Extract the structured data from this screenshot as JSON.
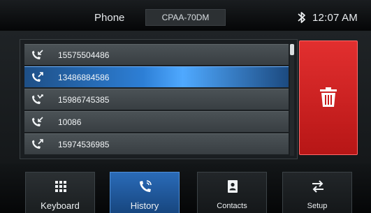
{
  "header": {
    "title": "Phone",
    "device": "CPAA-70DM",
    "time": "12:07 AM",
    "bluetooth_icon": "bluetooth-icon"
  },
  "call_history": [
    {
      "number": "15575504486",
      "icon": "incoming-call-icon",
      "selected": false
    },
    {
      "number": "13486884586",
      "icon": "outgoing-call-icon",
      "selected": true
    },
    {
      "number": "15986745385",
      "icon": "missed-call-icon",
      "selected": false
    },
    {
      "number": "10086",
      "icon": "incoming-call-icon",
      "selected": false
    },
    {
      "number": "15974536985",
      "icon": "outgoing-call-icon",
      "selected": false
    }
  ],
  "delete_button": {
    "icon": "trash-icon"
  },
  "tabs": [
    {
      "label": "Keyboard",
      "icon": "keypad-icon"
    },
    {
      "label": "History",
      "icon": "phone-history-icon"
    },
    {
      "label": "Contacts",
      "icon": "contacts-icon"
    },
    {
      "label": "Setup",
      "icon": "setup-icon"
    }
  ],
  "colors": {
    "accent_blue": "#2d7fd6",
    "delete_red": "#d22323",
    "background": "#0b0d0f"
  }
}
